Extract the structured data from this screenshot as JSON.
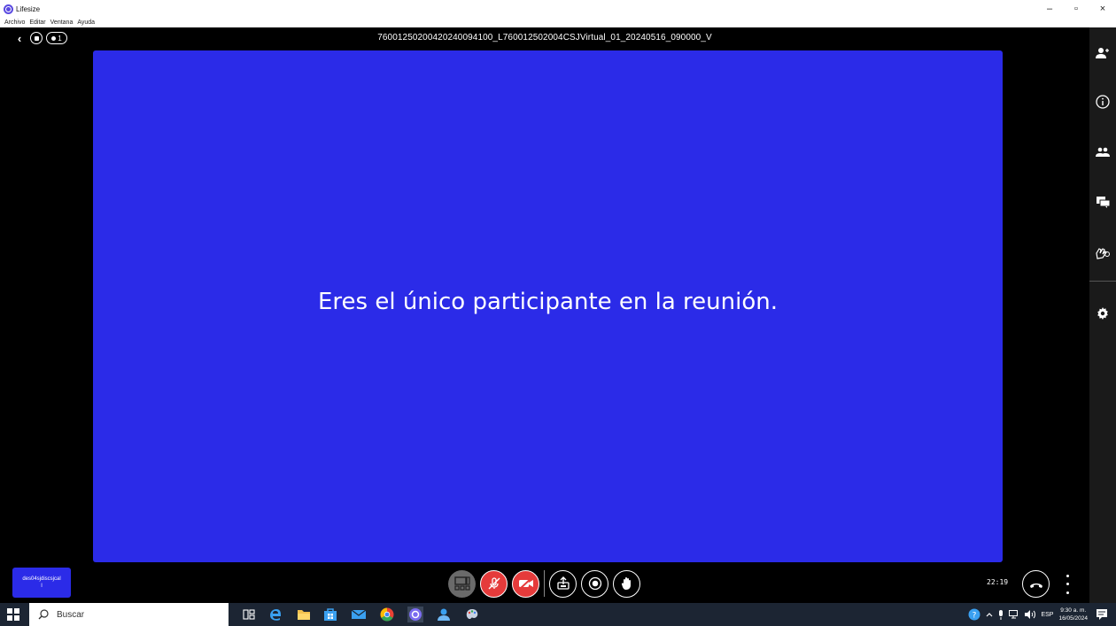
{
  "window": {
    "app_title": "Lifesize",
    "minimize": "–",
    "maximize": "▫",
    "close": "×"
  },
  "menu": {
    "items": [
      "Archivo",
      "Editar",
      "Ventana",
      "Ayuda"
    ]
  },
  "topbar": {
    "back_icon": "‹",
    "participant_count": "1",
    "meeting_title": "76001250200420240094100_L760012502004CSJVirtual_01_20240516_090000_V"
  },
  "main": {
    "alone_message": "Eres el único participante en la reunión."
  },
  "self_view": {
    "name": "des04sjdiscsjcal",
    "line2": "l"
  },
  "controls": {
    "timer": "22:19",
    "accent_off": "#e53b3b",
    "video_bg": "#2b2be8"
  },
  "taskbar": {
    "search_placeholder": "Buscar",
    "language": "ESP",
    "time": "9:30 a. m.",
    "date": "16/05/2024"
  }
}
